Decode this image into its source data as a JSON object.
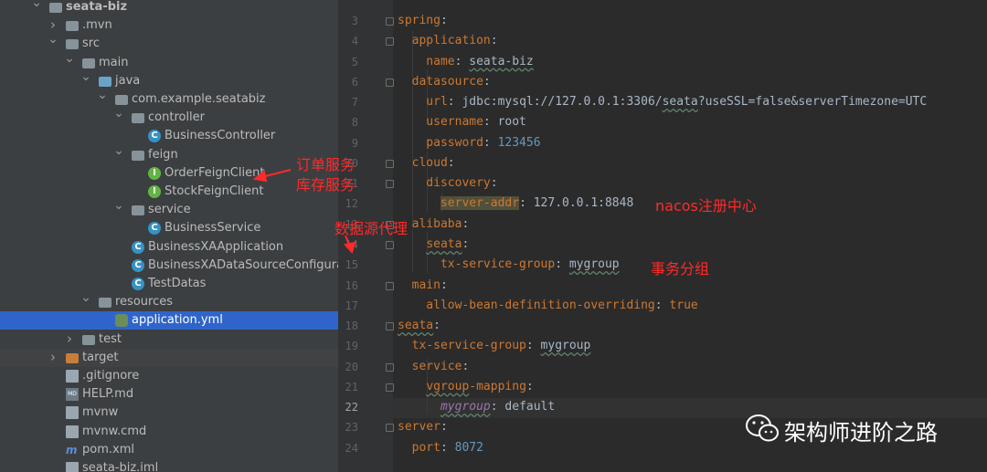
{
  "project_tree": [
    {
      "label": "seata-biz",
      "icon": "module-folder-icon",
      "expanded": true
    },
    {
      "label": ".mvn",
      "icon": "folder-icon",
      "expanded": false
    },
    {
      "label": "src",
      "icon": "folder-icon",
      "expanded": true
    },
    {
      "label": "main",
      "icon": "folder-icon",
      "expanded": true
    },
    {
      "label": "java",
      "icon": "source-folder-icon",
      "expanded": true
    },
    {
      "label": "com.example.seatabiz",
      "icon": "package-icon",
      "expanded": true
    },
    {
      "label": "controller",
      "icon": "package-icon",
      "expanded": true
    },
    {
      "label": "BusinessController",
      "icon": "class-icon"
    },
    {
      "label": "feign",
      "icon": "package-icon",
      "expanded": true
    },
    {
      "label": "OrderFeignClient",
      "icon": "interface-icon"
    },
    {
      "label": "StockFeignClient",
      "icon": "interface-icon"
    },
    {
      "label": "service",
      "icon": "package-icon",
      "expanded": true
    },
    {
      "label": "BusinessService",
      "icon": "class-icon"
    },
    {
      "label": "BusinessXAApplication",
      "icon": "spring-class-icon"
    },
    {
      "label": "BusinessXADataSourceConfiguratio",
      "icon": "class-icon"
    },
    {
      "label": "TestDatas",
      "icon": "class-icon"
    },
    {
      "label": "resources",
      "icon": "resources-folder-icon",
      "expanded": true
    },
    {
      "label": "application.yml",
      "icon": "yaml-file-icon",
      "selected": true
    },
    {
      "label": "test",
      "icon": "folder-icon",
      "expanded": false
    },
    {
      "label": "target",
      "icon": "excluded-folder-icon",
      "expanded": false
    },
    {
      "label": ".gitignore",
      "icon": "file-icon"
    },
    {
      "label": "HELP.md",
      "icon": "markdown-file-icon"
    },
    {
      "label": "mvnw",
      "icon": "file-icon"
    },
    {
      "label": "mvnw.cmd",
      "icon": "file-icon"
    },
    {
      "label": "pom.xml",
      "icon": "maven-file-icon"
    },
    {
      "label": "seata-biz.iml",
      "icon": "file-icon"
    }
  ],
  "editor": {
    "line_numbers": [
      "3",
      "4",
      "5",
      "6",
      "7",
      "8",
      "9",
      "10",
      "11",
      "12",
      "13",
      "14",
      "15",
      "16",
      "17",
      "18",
      "19",
      "20",
      "21",
      "22",
      "23",
      "24"
    ],
    "current_line": "22",
    "lines": [
      [
        {
          "t": "spring",
          "c": "key"
        },
        {
          "t": ":",
          "c": "val"
        }
      ],
      [
        {
          "t": "  application",
          "c": "key"
        },
        {
          "t": ":",
          "c": "val"
        }
      ],
      [
        {
          "t": "    name",
          "c": "key"
        },
        {
          "t": ": ",
          "c": "val"
        },
        {
          "t": "seata-biz",
          "c": "val squig"
        }
      ],
      [
        {
          "t": "  datasource",
          "c": "key"
        },
        {
          "t": ":",
          "c": "val"
        }
      ],
      [
        {
          "t": "    url",
          "c": "key"
        },
        {
          "t": ": jdbc:mysql://127.0.0.1:3306/",
          "c": "val"
        },
        {
          "t": "seata",
          "c": "val squig"
        },
        {
          "t": "?useSSL=false&serverTimezone=UTC",
          "c": "val"
        }
      ],
      [
        {
          "t": "    username",
          "c": "key"
        },
        {
          "t": ": root",
          "c": "val"
        }
      ],
      [
        {
          "t": "    password",
          "c": "key"
        },
        {
          "t": ": ",
          "c": "val"
        },
        {
          "t": "123456",
          "c": "num"
        }
      ],
      [
        {
          "t": "  cloud",
          "c": "key"
        },
        {
          "t": ":",
          "c": "val"
        }
      ],
      [
        {
          "t": "    discovery",
          "c": "key"
        },
        {
          "t": ":",
          "c": "val"
        }
      ],
      [
        {
          "t": "      ",
          "c": "val"
        },
        {
          "t": "server-addr",
          "c": "key hl"
        },
        {
          "t": ": 127.0.0.1:8848",
          "c": "val"
        }
      ],
      [
        {
          "t": "  alibaba",
          "c": "key"
        },
        {
          "t": ":",
          "c": "val"
        }
      ],
      [
        {
          "t": "    ",
          "c": "val"
        },
        {
          "t": "seata",
          "c": "key squig"
        },
        {
          "t": ":",
          "c": "val"
        }
      ],
      [
        {
          "t": "      tx-service-group",
          "c": "key"
        },
        {
          "t": ": ",
          "c": "val"
        },
        {
          "t": "mygroup",
          "c": "val squig"
        }
      ],
      [
        {
          "t": "  main",
          "c": "key"
        },
        {
          "t": ":",
          "c": "val"
        }
      ],
      [
        {
          "t": "    allow-bean-definition-overriding",
          "c": "key"
        },
        {
          "t": ": ",
          "c": "val"
        },
        {
          "t": "true",
          "c": "key"
        }
      ],
      [
        {
          "t": "seata",
          "c": "key squig"
        },
        {
          "t": ":",
          "c": "val"
        }
      ],
      [
        {
          "t": "  tx-service-group",
          "c": "key"
        },
        {
          "t": ": ",
          "c": "val"
        },
        {
          "t": "mygroup",
          "c": "val squig"
        }
      ],
      [
        {
          "t": "  service",
          "c": "key"
        },
        {
          "t": ":",
          "c": "val"
        }
      ],
      [
        {
          "t": "    ",
          "c": "val"
        },
        {
          "t": "vgroup",
          "c": "key squig"
        },
        {
          "t": "-mapping",
          "c": "key"
        },
        {
          "t": ":",
          "c": "val"
        }
      ],
      [
        {
          "t": "      ",
          "c": "val"
        },
        {
          "t": "mygroup",
          "c": "ital squig"
        },
        {
          "t": ": default",
          "c": "val"
        }
      ],
      [
        {
          "t": "server",
          "c": "key"
        },
        {
          "t": ":",
          "c": "val"
        }
      ],
      [
        {
          "t": "  port",
          "c": "key"
        },
        {
          "t": ": ",
          "c": "val"
        },
        {
          "t": "8072",
          "c": "num"
        }
      ]
    ]
  },
  "annotations": {
    "order_service": "订单服务",
    "stock_service": "库存服务",
    "datasource_proxy": "数据源代理",
    "nacos_registry": "nacos注册中心",
    "tx_group": "事务分组",
    "color": "#ff2a2a"
  },
  "watermark": {
    "text": "架构师进阶之路",
    "icon": "wechat-icon"
  },
  "colors": {
    "tree_bg": "#3c3f41",
    "selection": "#2f65ca",
    "editor_bg": "#2b2b2b",
    "keyword": "#cc7832",
    "number": "#6897bb"
  }
}
